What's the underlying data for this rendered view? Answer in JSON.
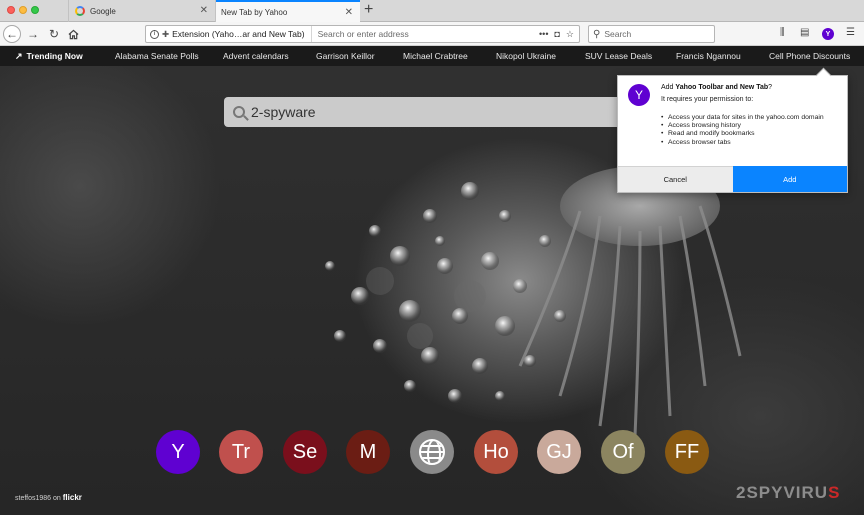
{
  "tabs": [
    {
      "label": "Google",
      "icon": "google-g-icon"
    },
    {
      "label": "New Tab by Yahoo",
      "icon": "none"
    }
  ],
  "newtab_label": "+",
  "navbar": {
    "identity_text": "Extension (Yaho…ar and New Tab)",
    "url_placeholder": "Search or enter address",
    "search_placeholder": "Search",
    "yahoo_letter": "Y"
  },
  "trending": {
    "heading": "Trending Now",
    "items": [
      "Alabama Senate Polls",
      "Advent calendars",
      "Garrison Keillor",
      "Michael Crabtree",
      "Nikopol Ukraine",
      "SUV Lease Deals",
      "Francis Ngannou",
      "Cell Phone Discounts"
    ]
  },
  "search": {
    "value": "2-spyware"
  },
  "popup": {
    "logo_letter": "Y",
    "title_prefix": "Add",
    "title_bold": "Yahoo Toolbar and New Tab",
    "title_suffix": "?",
    "subtitle": "It requires your permission to:",
    "permissions": [
      "Access your data for sites in the yahoo.com domain",
      "Access browsing history",
      "Read and modify bookmarks",
      "Access browser tabs"
    ],
    "cancel_label": "Cancel",
    "add_label": "Add"
  },
  "tiles": [
    {
      "label": "Y",
      "color": "#5f01d1"
    },
    {
      "label": "Tr",
      "color": "#c0504d"
    },
    {
      "label": "Se",
      "color": "#7a0f1c"
    },
    {
      "label": "M",
      "color": "#6b1d14"
    },
    {
      "label": "",
      "color": "#8a8a8a",
      "icon": "globe-icon"
    },
    {
      "label": "Ho",
      "color": "#b34e3c"
    },
    {
      "label": "GJ",
      "color": "#c9a99b"
    },
    {
      "label": "Of",
      "color": "#8c8560"
    },
    {
      "label": "FF",
      "color": "#8a5a12"
    }
  ],
  "credit": {
    "author": "steffos1986 on",
    "site": "flickr"
  },
  "watermark": {
    "part1": "2SPYVIRU",
    "part2": "S"
  },
  "colors": {
    "accent": "#0a84ff",
    "yahoo_purple": "#5f01d1"
  }
}
